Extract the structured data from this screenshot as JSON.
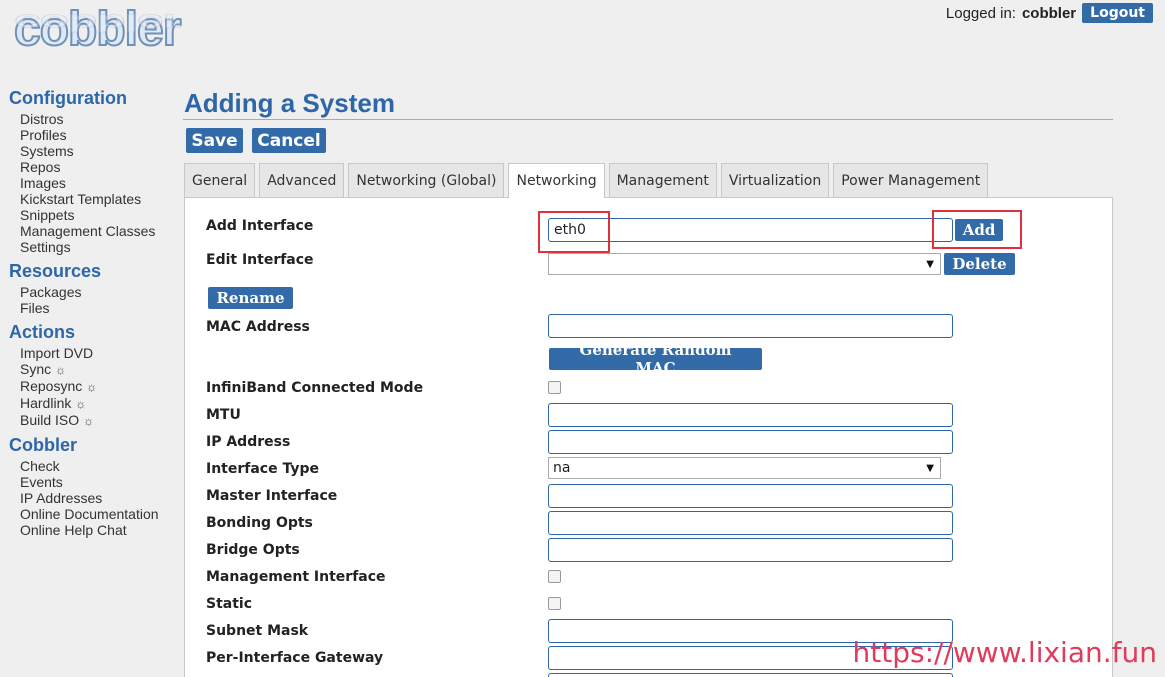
{
  "logo": {
    "text": "cobbler"
  },
  "userbar": {
    "logged_in_label": "Logged in:",
    "username": "cobbler",
    "logout_label": "Logout"
  },
  "sidebar": {
    "configuration": {
      "title": "Configuration",
      "items": [
        "Distros",
        "Profiles",
        "Systems",
        "Repos",
        "Images",
        "Kickstart Templates",
        "Snippets",
        "Management Classes",
        "Settings"
      ]
    },
    "resources": {
      "title": "Resources",
      "items": [
        "Packages",
        "Files"
      ]
    },
    "actions": {
      "title": "Actions",
      "items": [
        "Import DVD",
        "Sync",
        "Reposync",
        "Hardlink",
        "Build ISO"
      ],
      "busy_glyph": "☼"
    },
    "cobbler": {
      "title": "Cobbler",
      "items": [
        "Check",
        "Events",
        "IP Addresses",
        "Online Documentation",
        "Online Help Chat"
      ]
    }
  },
  "main": {
    "title": "Adding a System",
    "save_label": "Save",
    "cancel_label": "Cancel",
    "tabs": [
      "General",
      "Advanced",
      "Networking (Global)",
      "Networking",
      "Management",
      "Virtualization",
      "Power Management"
    ],
    "active_tab": "Networking"
  },
  "form": {
    "add_interface": {
      "label": "Add Interface",
      "value": "eth0",
      "button": "Add"
    },
    "edit_interface": {
      "label": "Edit Interface",
      "value": "",
      "button": "Delete"
    },
    "rename_button": "Rename",
    "mac_address": {
      "label": "MAC Address",
      "value": "",
      "button": "Generate Random MAC"
    },
    "infiniband": {
      "label": "InfiniBand Connected Mode",
      "checked": false
    },
    "mtu": {
      "label": "MTU",
      "value": ""
    },
    "ip_address": {
      "label": "IP Address",
      "value": ""
    },
    "interface_type": {
      "label": "Interface Type",
      "value": "na"
    },
    "master_interface": {
      "label": "Master Interface",
      "value": ""
    },
    "bonding_opts": {
      "label": "Bonding Opts",
      "value": ""
    },
    "bridge_opts": {
      "label": "Bridge Opts",
      "value": ""
    },
    "management_interface": {
      "label": "Management Interface",
      "checked": false
    },
    "static": {
      "label": "Static",
      "checked": false
    },
    "subnet_mask": {
      "label": "Subnet Mask",
      "value": ""
    },
    "per_interface_gateway": {
      "label": "Per-Interface Gateway",
      "value": ""
    }
  },
  "watermark": "https://www.lixian.fun",
  "colors": {
    "accent": "#336ba8",
    "heading": "#2e66a8",
    "highlight": "#e0303a",
    "watermark": "#e23a5a"
  }
}
